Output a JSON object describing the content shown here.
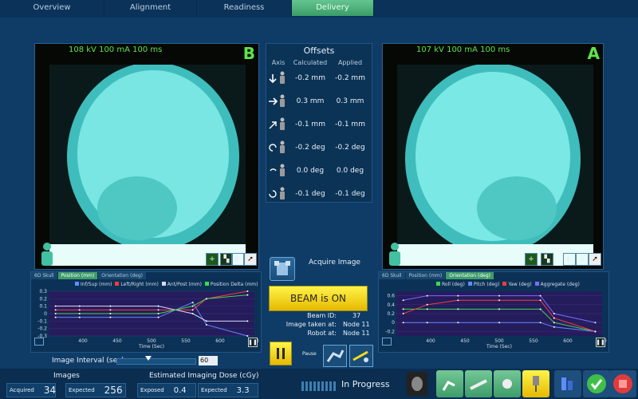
{
  "tabs": [
    {
      "label": "Overview"
    },
    {
      "label": "Alignment"
    },
    {
      "label": "Readiness"
    },
    {
      "label": "Delivery"
    }
  ],
  "panel_b": {
    "info": "108 kV 100 mA 100 ms",
    "letter": "B"
  },
  "panel_a": {
    "info": "107 kV 100 mA 100 ms",
    "letter": "A"
  },
  "offsets": {
    "title": "Offsets",
    "headers": {
      "axis": "Axis",
      "calculated": "Calculated",
      "applied": "Applied"
    },
    "rows": [
      {
        "icon": "arrow-down-icon",
        "calculated": "-0.2 mm",
        "applied": "-0.2 mm"
      },
      {
        "icon": "arrow-right-icon",
        "calculated": "0.3 mm",
        "applied": "0.3 mm"
      },
      {
        "icon": "arrow-diagonal-icon",
        "calculated": "-0.1 mm",
        "applied": "-0.1 mm"
      },
      {
        "icon": "rotate-left-icon",
        "calculated": "-0.2 deg",
        "applied": "-0.2 deg"
      },
      {
        "icon": "rotate-pitch-icon",
        "calculated": "0.0 deg",
        "applied": "0.0 deg"
      },
      {
        "icon": "rotate-yaw-icon",
        "calculated": "-0.1 deg",
        "applied": "-0.1 deg"
      }
    ]
  },
  "acquire": {
    "label": "Acquire Image"
  },
  "beam": {
    "label": "BEAM is ON"
  },
  "beam_info": {
    "beam_id_label": "Beam ID:",
    "beam_id": "37",
    "taken_label": "Image taken at:",
    "taken": "Node 11",
    "robot_label": "Robot at:",
    "robot": "Node 11"
  },
  "pause": {
    "label": "Pause"
  },
  "left_chart": {
    "tabs": [
      "6D Skull",
      "Position (mm)",
      "Orientation (deg)"
    ],
    "active_tab": 1,
    "legend": [
      {
        "name": "Inf/Sup (mm)",
        "color": "#5f8cff"
      },
      {
        "name": "Left/Right (mm)",
        "color": "#ff3b3b"
      },
      {
        "name": "Ant/Post (mm)",
        "color": "#d9d9ff"
      },
      {
        "name": "Position Delta (mm)",
        "color": "#3fd84a"
      }
    ],
    "xlabel": "Time (Sec)",
    "xticks": [
      "400",
      "450",
      "500",
      "550",
      "600",
      "650"
    ],
    "yticks": [
      "0.3",
      "0.2",
      "0.1",
      "0",
      "-0.1",
      "-0.2",
      "-0.3"
    ]
  },
  "right_chart": {
    "tabs": [
      "6D Skull",
      "Position (mm)",
      "Orientation (deg)"
    ],
    "active_tab": 2,
    "legend": [
      {
        "name": "Roll (deg)",
        "color": "#3fd84a"
      },
      {
        "name": "Pitch (deg)",
        "color": "#5f8cff"
      },
      {
        "name": "Yaw (deg)",
        "color": "#ff3b3b"
      },
      {
        "name": "Aggregate (deg)",
        "color": "#7a6cff"
      }
    ],
    "xlabel": "Time (Sec)",
    "xticks": [
      "400",
      "450",
      "500",
      "550",
      "600",
      "650"
    ],
    "yticks": [
      "0.6",
      "0.4",
      "0.2",
      "0",
      "-0.2"
    ]
  },
  "chart_data": [
    {
      "type": "line",
      "xlabel": "Time (Sec)",
      "xlim": [
        350,
        650
      ],
      "ylim": [
        -0.3,
        0.3
      ],
      "x": [
        360,
        395,
        440,
        510,
        560,
        580,
        640
      ],
      "series": [
        {
          "name": "Inf/Sup (mm)",
          "values": [
            -0.05,
            -0.05,
            -0.05,
            -0.05,
            0.15,
            -0.15,
            -0.3
          ]
        },
        {
          "name": "Left/Right (mm)",
          "values": [
            0.05,
            0.05,
            0.05,
            0.05,
            0.05,
            0.2,
            0.3
          ]
        },
        {
          "name": "Ant/Post (mm)",
          "values": [
            0.1,
            0.1,
            0.1,
            0.1,
            0.0,
            -0.1,
            -0.1
          ]
        },
        {
          "name": "Position Delta (mm)",
          "values": [
            0.0,
            0.0,
            0.0,
            0.0,
            0.1,
            0.2,
            0.25
          ]
        }
      ]
    },
    {
      "type": "line",
      "xlabel": "Time (Sec)",
      "xlim": [
        350,
        650
      ],
      "ylim": [
        -0.3,
        0.7
      ],
      "x": [
        360,
        395,
        440,
        500,
        560,
        580,
        640
      ],
      "series": [
        {
          "name": "Roll (deg)",
          "values": [
            0.3,
            0.3,
            0.3,
            0.3,
            0.3,
            0.0,
            -0.2
          ]
        },
        {
          "name": "Pitch (deg)",
          "values": [
            0.0,
            0.0,
            0.0,
            0.0,
            0.0,
            -0.1,
            -0.2
          ]
        },
        {
          "name": "Yaw (deg)",
          "values": [
            0.2,
            0.4,
            0.5,
            0.5,
            0.5,
            0.1,
            -0.2
          ]
        },
        {
          "name": "Aggregate (deg)",
          "values": [
            0.5,
            0.6,
            0.6,
            0.6,
            0.6,
            0.2,
            0.0
          ]
        }
      ]
    }
  ],
  "interval": {
    "label": "Image Interval (sec)",
    "value": "60",
    "slider_fraction": 0.4
  },
  "images": {
    "title": "Images",
    "acquired_label": "Acquired",
    "acquired": "34",
    "expected_label": "Expected",
    "expected": "256"
  },
  "dose": {
    "title": "Estimated Imaging Dose (cGy)",
    "exposed_label": "Exposed",
    "exposed": "0.4",
    "expected_label": "Expected",
    "expected": "3.3"
  },
  "status": {
    "label": "In Progress"
  },
  "colors": {
    "accent": "#3f9c6a",
    "beam": "#f5dd1e",
    "green_text": "#5ee44a"
  }
}
